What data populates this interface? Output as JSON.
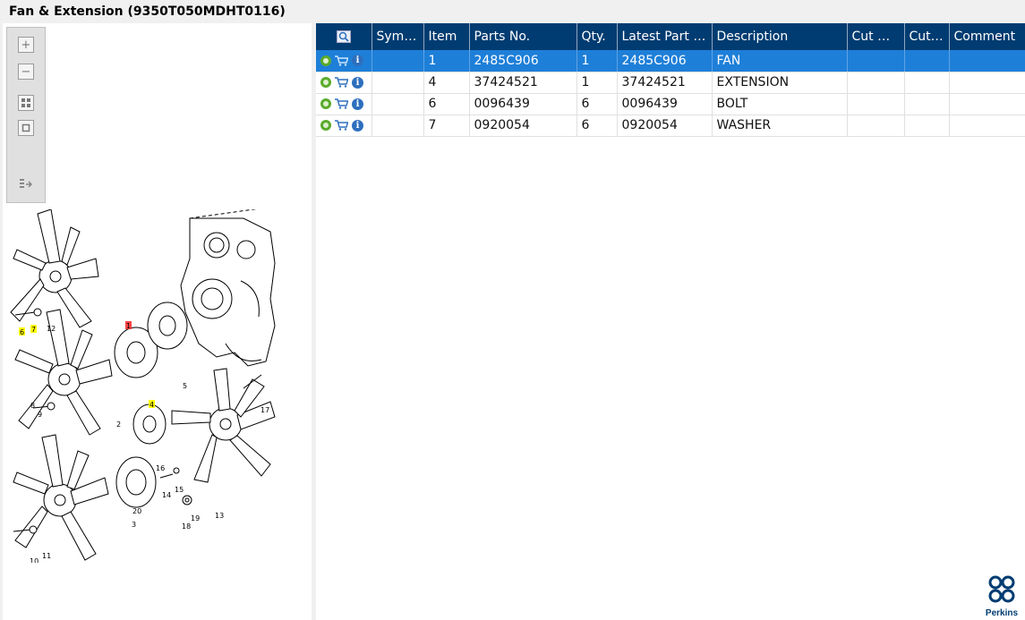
{
  "window": {
    "title": "Fan & Extension (9350T050MDHT0116)"
  },
  "toolbar": {
    "zoom_in_icon": "plus-box",
    "zoom_out_icon": "minus-box",
    "fit_icon": "grid-box",
    "actual_icon": "square-box",
    "export_icon": "list-arrow"
  },
  "diagram": {
    "callouts": [
      "1",
      "2",
      "3",
      "4",
      "5",
      "6",
      "7",
      "8",
      "9",
      "10",
      "11",
      "12",
      "13",
      "14",
      "15",
      "16",
      "17",
      "18",
      "19",
      "20"
    ],
    "highlighted_callouts": [
      "4",
      "6",
      "7"
    ],
    "selected_callout": "1",
    "colors": {
      "highlight": "#ffff00",
      "selected": "#ff4444"
    }
  },
  "table": {
    "columns": [
      "",
      "Symb...",
      "Item",
      "Parts No.",
      "Qty.",
      "Latest Part No.",
      "Description",
      "Cut Out",
      "Cut In",
      "Comment"
    ],
    "rows": [
      {
        "item": "1",
        "parts_no": "2485C906",
        "qty": "1",
        "latest": "2485C906",
        "description": "FAN",
        "selected": true
      },
      {
        "item": "4",
        "parts_no": "37424521",
        "qty": "1",
        "latest": "37424521",
        "description": "EXTENSION"
      },
      {
        "item": "6",
        "parts_no": "0096439",
        "qty": "6",
        "latest": "0096439",
        "description": "BOLT"
      },
      {
        "item": "7",
        "parts_no": "0920054",
        "qty": "6",
        "latest": "0920054",
        "description": "WASHER"
      }
    ],
    "colors": {
      "header": "#003c71",
      "selected": "#1e7fd8"
    }
  },
  "logo": {
    "text": "Perkins"
  }
}
